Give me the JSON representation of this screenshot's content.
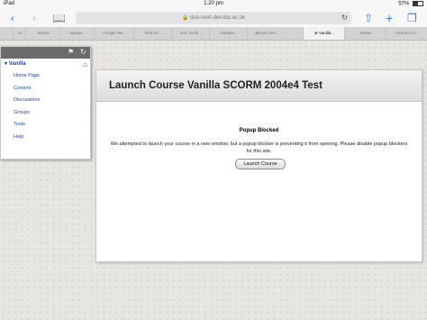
{
  "status": {
    "device": "iPad",
    "time": "1:20 pm",
    "battery": "57%"
  },
  "toolbar": {
    "url": "duo-next-dev.dur.ac.uk"
  },
  "tabs": [
    "ut",
    "Mount",
    "opnew...",
    "Google Ma...",
    "Find ho...",
    "IAS: Onlin...",
    "Natalee...",
    "Blount Get...",
    "Vanilla...",
    "Mewo",
    "Farmers fo..."
  ],
  "sidebar": {
    "course": "Vanilla",
    "items": [
      "Home Page",
      "Content",
      "Discussions",
      "Groups",
      "Tools",
      "Help"
    ]
  },
  "main": {
    "title": "Launch Course Vanilla SCORM 2004e4 Test",
    "popup_title": "Popup Blocked",
    "popup_message": "We attempted to launch your course in a new window, but a popup blocker is preventing it from opening. Please disable popup blockers for this site.",
    "launch_label": "Launch Course"
  }
}
